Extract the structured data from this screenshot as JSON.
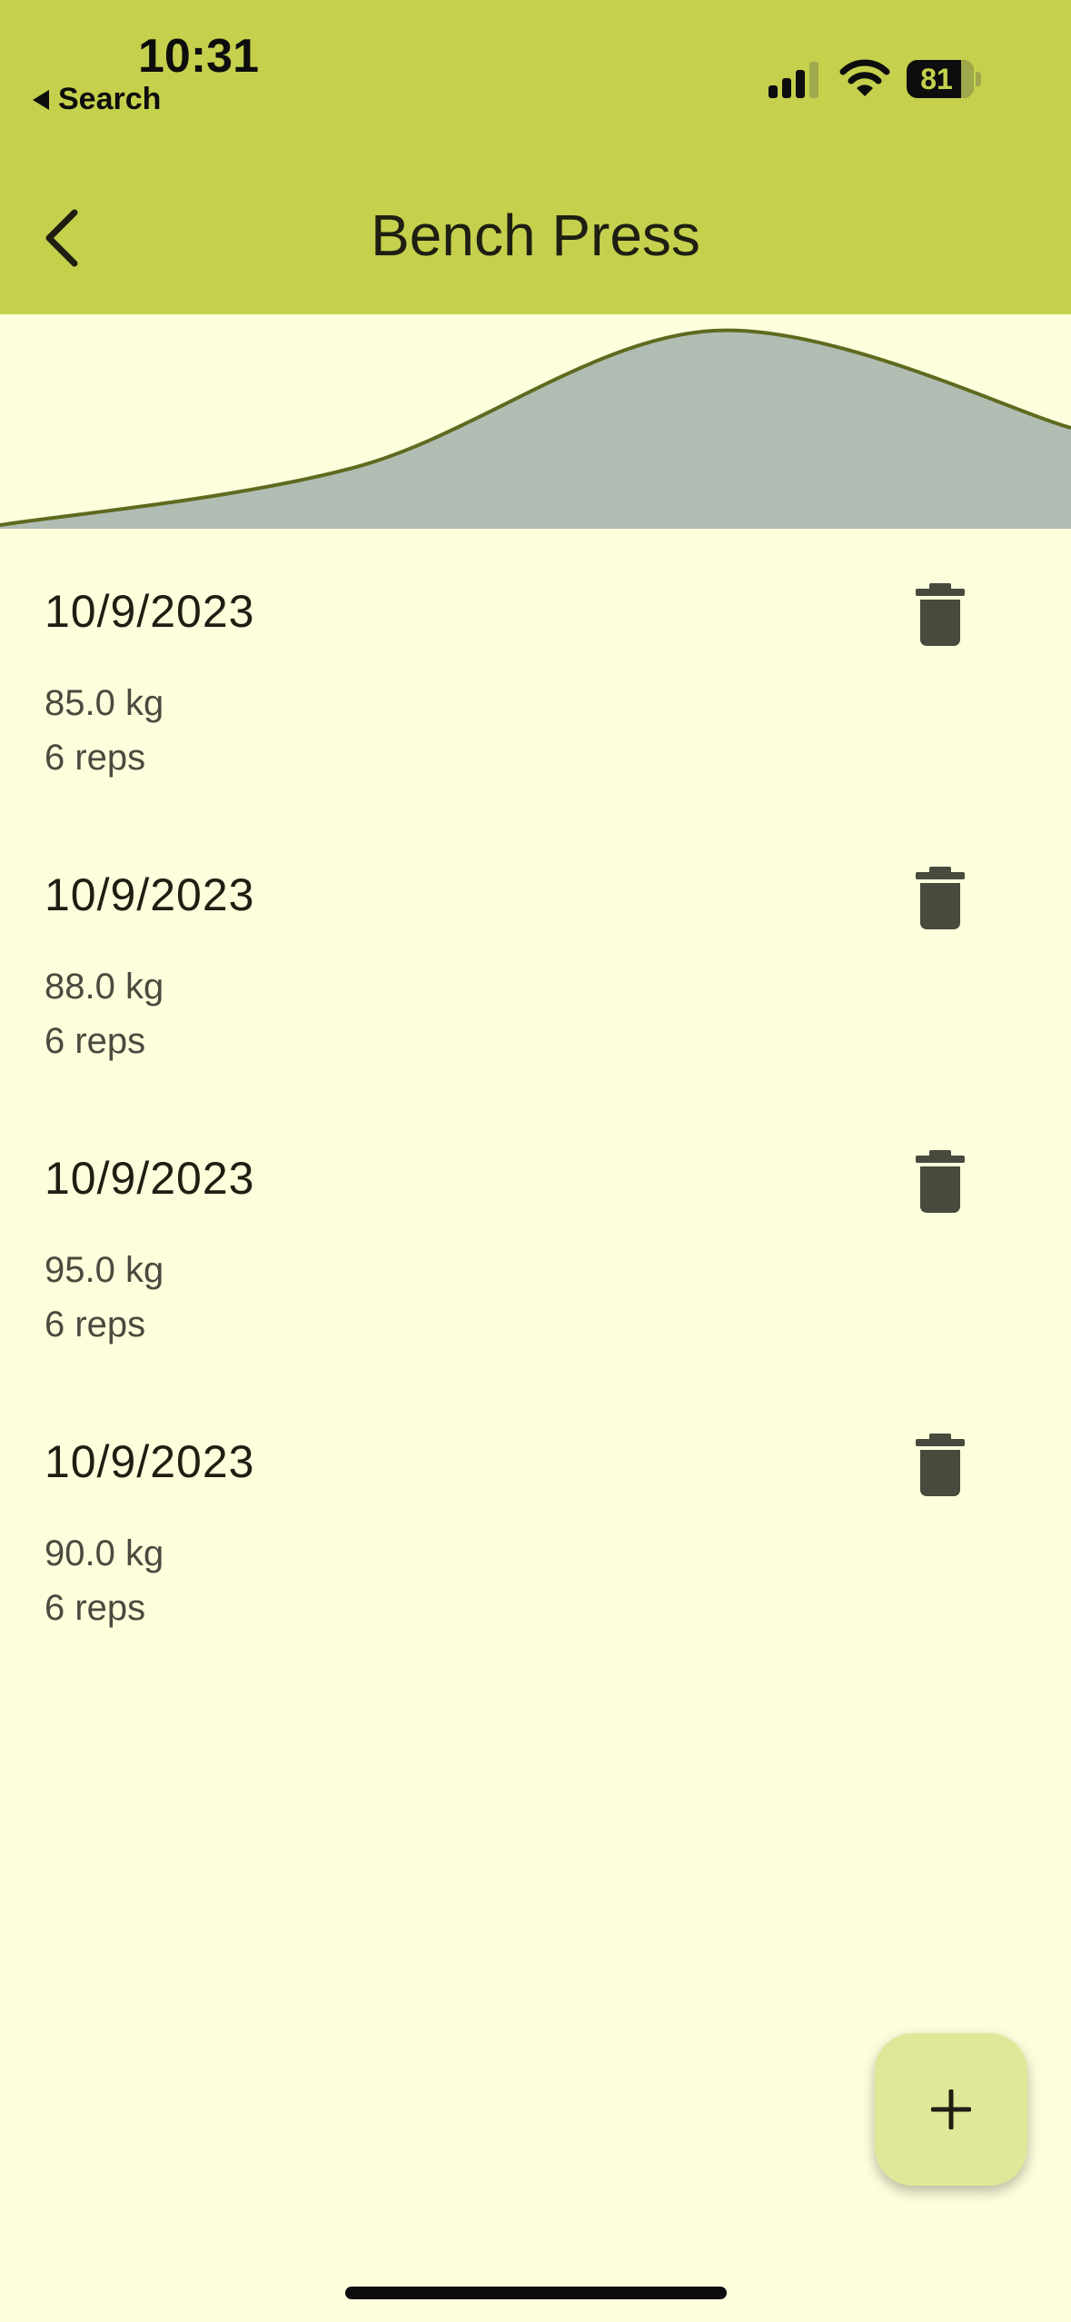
{
  "status_bar": {
    "time": "10:31",
    "back_app_label": "Search",
    "battery_level": "81"
  },
  "header": {
    "title": "Bench Press"
  },
  "chart_data": {
    "type": "area",
    "x": [
      "10/9/2023",
      "10/9/2023",
      "10/9/2023",
      "10/9/2023"
    ],
    "series": [
      {
        "values": [
          85.0,
          88.0,
          95.0,
          90.0
        ]
      }
    ],
    "grid": false,
    "axes_visible": false,
    "ylim": [
      85.0,
      95.0
    ],
    "colors": {
      "line": "#5e6a1e",
      "fill": "#b1bdb3"
    }
  },
  "entries": [
    {
      "date": "10/9/2023",
      "weight": "85.0 kg",
      "reps": "6 reps"
    },
    {
      "date": "10/9/2023",
      "weight": "88.0 kg",
      "reps": "6 reps"
    },
    {
      "date": "10/9/2023",
      "weight": "95.0 kg",
      "reps": "6 reps"
    },
    {
      "date": "10/9/2023",
      "weight": "90.0 kg",
      "reps": "6 reps"
    }
  ],
  "icons": {
    "back": "chevron-left-icon",
    "delete": "trash-icon",
    "add": "plus-icon"
  },
  "colors": {
    "app_bar": "#c5d04d",
    "background": "#fdfedc",
    "fab": "#e1e799",
    "icon": "#474a3c"
  }
}
